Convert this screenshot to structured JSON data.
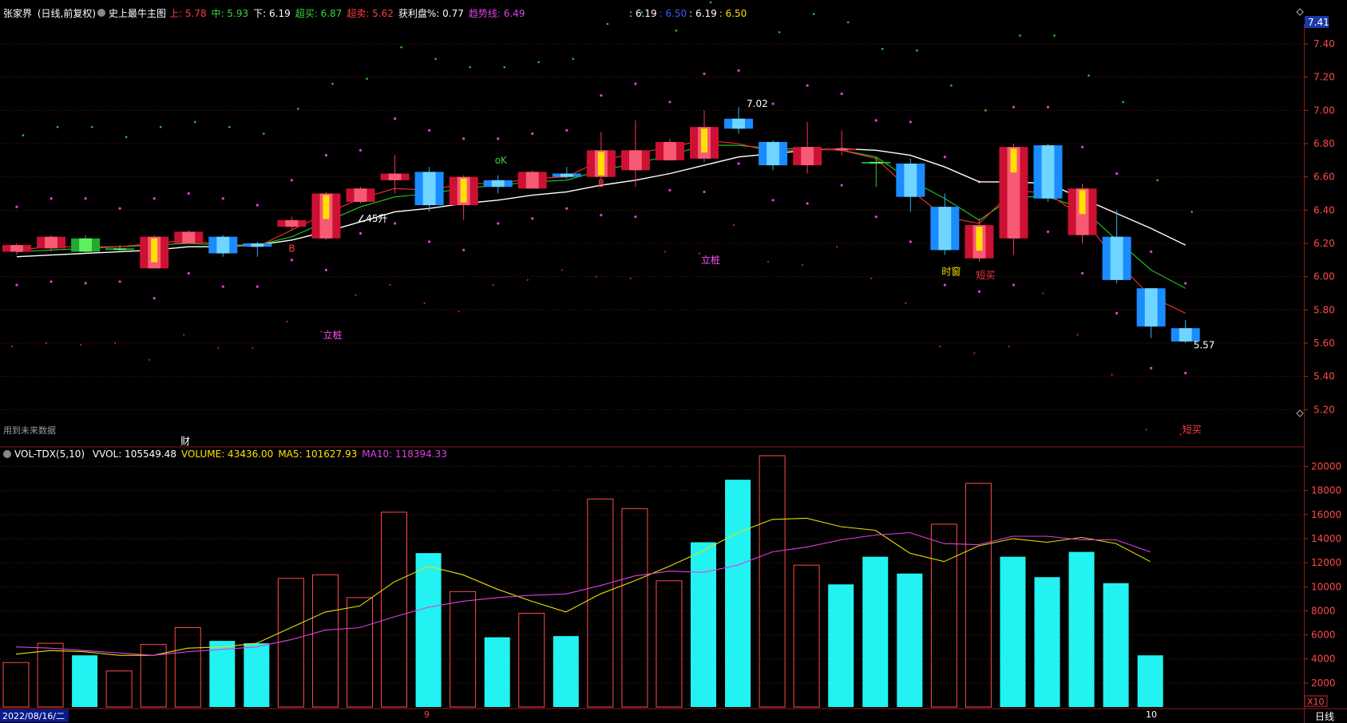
{
  "header": {
    "stock": "张家界",
    "mode": "(日线,前复权)",
    "indicator": "史上最牛主图",
    "fields": [
      {
        "text": "上: 5.78",
        "color": "#ff3b3b"
      },
      {
        "text": "中: 5.93",
        "color": "#3bd43b"
      },
      {
        "text": "下: 6.19",
        "color": "#ffffff"
      },
      {
        "text": "超买: 6.87",
        "color": "#3bd43b"
      },
      {
        "text": "超卖: 5.62",
        "color": "#ff3b3b"
      },
      {
        "text": "获利盘%: 0.77",
        "color": "#ffffff"
      },
      {
        "text": "趋势线: 6.49",
        "color": "#e040e0"
      }
    ],
    "right_fields": [
      {
        "text": ": 6.19",
        "color": "#ffffff"
      },
      {
        "text": ": 6.50",
        "color": "#3a5cff"
      },
      {
        "text": ": 6.19",
        "color": "#ffffff"
      },
      {
        "text": ": 6.50",
        "color": "#ffe000"
      }
    ],
    "price_badge": "7.41"
  },
  "vol_header": {
    "name": "VOL-TDX(5,10)",
    "fields": [
      {
        "text": "VVOL: 105549.48",
        "color": "#ffffff"
      },
      {
        "text": "VOLUME: 43436.00",
        "color": "#ffe000"
      },
      {
        "text": "MA5: 101627.93",
        "color": "#ffe000"
      },
      {
        "text": "MA10: 118394.33",
        "color": "#e040e0"
      }
    ]
  },
  "notes": {
    "future_data": "用到未来数据",
    "fin_marker": "财",
    "date_label": "2022/08/16/二",
    "period": "日线",
    "vol_unit": "X10",
    "month_9": "9",
    "month_10": "10"
  },
  "annotations": [
    {
      "text": "立桩",
      "color": "#ff55ff",
      "candle": 9,
      "price": 5.63
    },
    {
      "text": "立桩",
      "color": "#ff55ff",
      "candle": 20,
      "price": 6.08
    },
    {
      "text": "∠45升",
      "color": "#ffffff",
      "candle": 10,
      "price": 6.33
    },
    {
      "text": "时窗",
      "color": "#ffe000",
      "candle": 27,
      "price": 6.01
    },
    {
      "text": "短买",
      "color": "#ff3b3b",
      "candle": 28,
      "price": 5.99
    },
    {
      "text": "短买",
      "color": "#ff3b3b",
      "candle": 34,
      "price": 5.06
    },
    {
      "text": "B",
      "color": "#ff3b3b",
      "candle": 8,
      "price": 6.15
    },
    {
      "text": "B",
      "color": "#ff3b3b",
      "candle": 17,
      "price": 6.54
    },
    {
      "text": "oK",
      "color": "#3bd43b",
      "candle": 14,
      "price": 6.68
    },
    {
      "text": "7.02",
      "color": "#ffffff",
      "candle": 21,
      "price": 7.02
    },
    {
      "text": "5.57",
      "color": "#ffffff",
      "candle": 34,
      "price": 5.57
    }
  ],
  "chart_data": [
    {
      "type": "candlestick",
      "title": "史上最牛主图",
      "y_ticks": [
        5.2,
        5.4,
        5.6,
        5.8,
        6.0,
        6.2,
        6.4,
        6.6,
        6.8,
        7.0,
        7.2,
        7.4
      ],
      "ylim": [
        5.0,
        7.52
      ],
      "candles": [
        {
          "o": 6.15,
          "c": 6.19,
          "h": 6.2,
          "l": 6.13,
          "color": "red"
        },
        {
          "o": 6.17,
          "c": 6.24,
          "h": 6.25,
          "l": 6.15,
          "color": "red"
        },
        {
          "o": 6.23,
          "c": 6.15,
          "h": 6.25,
          "l": 6.14,
          "color": "green"
        },
        {
          "o": 6.17,
          "c": 6.17,
          "h": 6.19,
          "l": 6.15,
          "color": "green"
        },
        {
          "o": 6.05,
          "c": 6.24,
          "h": 6.25,
          "l": 6.05,
          "color": "red"
        },
        {
          "o": 6.2,
          "c": 6.27,
          "h": 6.28,
          "l": 6.2,
          "color": "red"
        },
        {
          "o": 6.24,
          "c": 6.14,
          "h": 6.25,
          "l": 6.12,
          "color": "blue"
        },
        {
          "o": 6.2,
          "c": 6.18,
          "h": 6.21,
          "l": 6.12,
          "color": "blue"
        },
        {
          "o": 6.3,
          "c": 6.34,
          "h": 6.36,
          "l": 6.28,
          "color": "red"
        },
        {
          "o": 6.23,
          "c": 6.5,
          "h": 6.51,
          "l": 6.22,
          "color": "red"
        },
        {
          "o": 6.45,
          "c": 6.53,
          "h": 6.54,
          "l": 6.44,
          "color": "red"
        },
        {
          "o": 6.58,
          "c": 6.62,
          "h": 6.73,
          "l": 6.5,
          "color": "red"
        },
        {
          "o": 6.63,
          "c": 6.43,
          "h": 6.66,
          "l": 6.39,
          "color": "blue"
        },
        {
          "o": 6.43,
          "c": 6.6,
          "h": 6.61,
          "l": 6.34,
          "color": "red"
        },
        {
          "o": 6.58,
          "c": 6.54,
          "h": 6.61,
          "l": 6.5,
          "color": "blue"
        },
        {
          "o": 6.53,
          "c": 6.63,
          "h": 6.64,
          "l": 6.53,
          "color": "red"
        },
        {
          "o": 6.62,
          "c": 6.6,
          "h": 6.66,
          "l": 6.59,
          "color": "blue"
        },
        {
          "o": 6.6,
          "c": 6.76,
          "h": 6.87,
          "l": 6.55,
          "color": "red"
        },
        {
          "o": 6.64,
          "c": 6.76,
          "h": 6.94,
          "l": 6.54,
          "color": "red"
        },
        {
          "o": 6.7,
          "c": 6.81,
          "h": 6.83,
          "l": 6.7,
          "color": "red"
        },
        {
          "o": 6.71,
          "c": 6.9,
          "h": 7.0,
          "l": 6.69,
          "color": "red"
        },
        {
          "o": 6.95,
          "c": 6.89,
          "h": 7.02,
          "l": 6.86,
          "color": "blue"
        },
        {
          "o": 6.81,
          "c": 6.67,
          "h": 6.82,
          "l": 6.64,
          "color": "blue"
        },
        {
          "o": 6.67,
          "c": 6.78,
          "h": 6.93,
          "l": 6.62,
          "color": "red"
        },
        {
          "o": 6.76,
          "c": 6.77,
          "h": 6.88,
          "l": 6.73,
          "color": "red"
        },
        {
          "o": 6.69,
          "c": 6.69,
          "h": 6.72,
          "l": 6.54,
          "color": "green"
        },
        {
          "o": 6.68,
          "c": 6.48,
          "h": 6.71,
          "l": 6.39,
          "color": "blue"
        },
        {
          "o": 6.42,
          "c": 6.16,
          "h": 6.5,
          "l": 6.13,
          "color": "blue"
        },
        {
          "o": 6.11,
          "c": 6.31,
          "h": 6.35,
          "l": 6.09,
          "color": "red"
        },
        {
          "o": 6.23,
          "c": 6.78,
          "h": 6.8,
          "l": 6.13,
          "color": "red"
        },
        {
          "o": 6.79,
          "c": 6.47,
          "h": 6.8,
          "l": 6.45,
          "color": "blue"
        },
        {
          "o": 6.53,
          "c": 6.25,
          "h": 6.56,
          "l": 6.2,
          "color": "red"
        },
        {
          "o": 6.24,
          "c": 5.98,
          "h": 6.4,
          "l": 5.96,
          "color": "blue"
        },
        {
          "o": 5.93,
          "c": 5.7,
          "h": 5.93,
          "l": 5.63,
          "color": "blue"
        },
        {
          "o": 5.69,
          "c": 5.61,
          "h": 5.74,
          "l": 5.6,
          "color": "blue"
        }
      ],
      "series": [
        {
          "name": "",
          "color": "#ffffff",
          "values": [
            6.12,
            6.13,
            6.14,
            6.15,
            6.16,
            6.18,
            6.18,
            6.19,
            6.22,
            6.27,
            6.33,
            6.39,
            6.41,
            6.44,
            6.46,
            6.49,
            6.51,
            6.55,
            6.58,
            6.62,
            6.67,
            6.72,
            6.74,
            6.76,
            6.77,
            6.76,
            6.73,
            6.66,
            6.57,
            6.57,
            6.56,
            6.47,
            6.38,
            6.29,
            6.19
          ]
        },
        {
          "name": "",
          "color": "#22cc22",
          "values": [
            6.15,
            6.16,
            6.17,
            6.18,
            6.19,
            6.2,
            6.19,
            6.19,
            6.24,
            6.33,
            6.42,
            6.48,
            6.5,
            6.53,
            6.55,
            6.57,
            6.58,
            6.64,
            6.68,
            6.73,
            6.79,
            6.79,
            6.77,
            6.77,
            6.76,
            6.72,
            6.58,
            6.47,
            6.34,
            6.48,
            6.48,
            6.41,
            6.22,
            6.04,
            5.93
          ]
        },
        {
          "name": "",
          "color": "#ff3030",
          "values": [
            6.16,
            6.18,
            6.18,
            6.18,
            6.2,
            6.22,
            6.19,
            6.18,
            6.28,
            6.38,
            6.47,
            6.53,
            6.52,
            6.56,
            6.56,
            6.59,
            6.6,
            6.7,
            6.74,
            6.78,
            6.82,
            6.8,
            6.75,
            6.77,
            6.76,
            6.71,
            6.52,
            6.36,
            6.32,
            6.52,
            6.5,
            6.36,
            6.09,
            5.88,
            5.78
          ]
        }
      ]
    },
    {
      "type": "bar",
      "title": "VOL-TDX(5,10)",
      "y_ticks": [
        2000,
        4000,
        6000,
        8000,
        10000,
        12000,
        14000,
        16000,
        18000,
        20000
      ],
      "ylim": [
        0,
        21500
      ],
      "volume": [
        3700,
        5300,
        4300,
        3000,
        5200,
        6600,
        5500,
        5300,
        10700,
        11000,
        9100,
        16200,
        12800,
        9600,
        5800,
        7800,
        5900,
        17300,
        16500,
        10500,
        13700,
        18900,
        20900,
        11800,
        10200,
        12500,
        11100,
        15200,
        18600,
        12500,
        10800,
        12900,
        10300,
        4300
      ],
      "solid": [
        false,
        false,
        true,
        false,
        false,
        false,
        true,
        true,
        false,
        false,
        false,
        false,
        true,
        false,
        true,
        false,
        true,
        false,
        false,
        false,
        true,
        true,
        false,
        false,
        true,
        true,
        true,
        false,
        false,
        true,
        true,
        true,
        true,
        true
      ],
      "series": [
        {
          "name": "MA5",
          "color": "#e8e000",
          "values": [
            4400,
            4700,
            4600,
            4300,
            4300,
            4900,
            5000,
            5300,
            6600,
            7900,
            8400,
            10400,
            11700,
            11000,
            9800,
            8800,
            7900,
            9400,
            10500,
            11700,
            13000,
            14500,
            15600,
            15700,
            15000,
            14700,
            12800,
            12100,
            13400,
            14000,
            13700,
            14100,
            13600,
            12100
          ]
        },
        {
          "name": "MA10",
          "color": "#e040e0",
          "values": [
            5000,
            4900,
            4700,
            4500,
            4300,
            4600,
            4800,
            5000,
            5600,
            6400,
            6600,
            7500,
            8300,
            8800,
            9100,
            9300,
            9400,
            10100,
            10900,
            11300,
            11200,
            11800,
            12900,
            13300,
            13900,
            14300,
            14500,
            13600,
            13500,
            14200,
            14200,
            13900,
            13900,
            12900
          ]
        }
      ]
    }
  ]
}
